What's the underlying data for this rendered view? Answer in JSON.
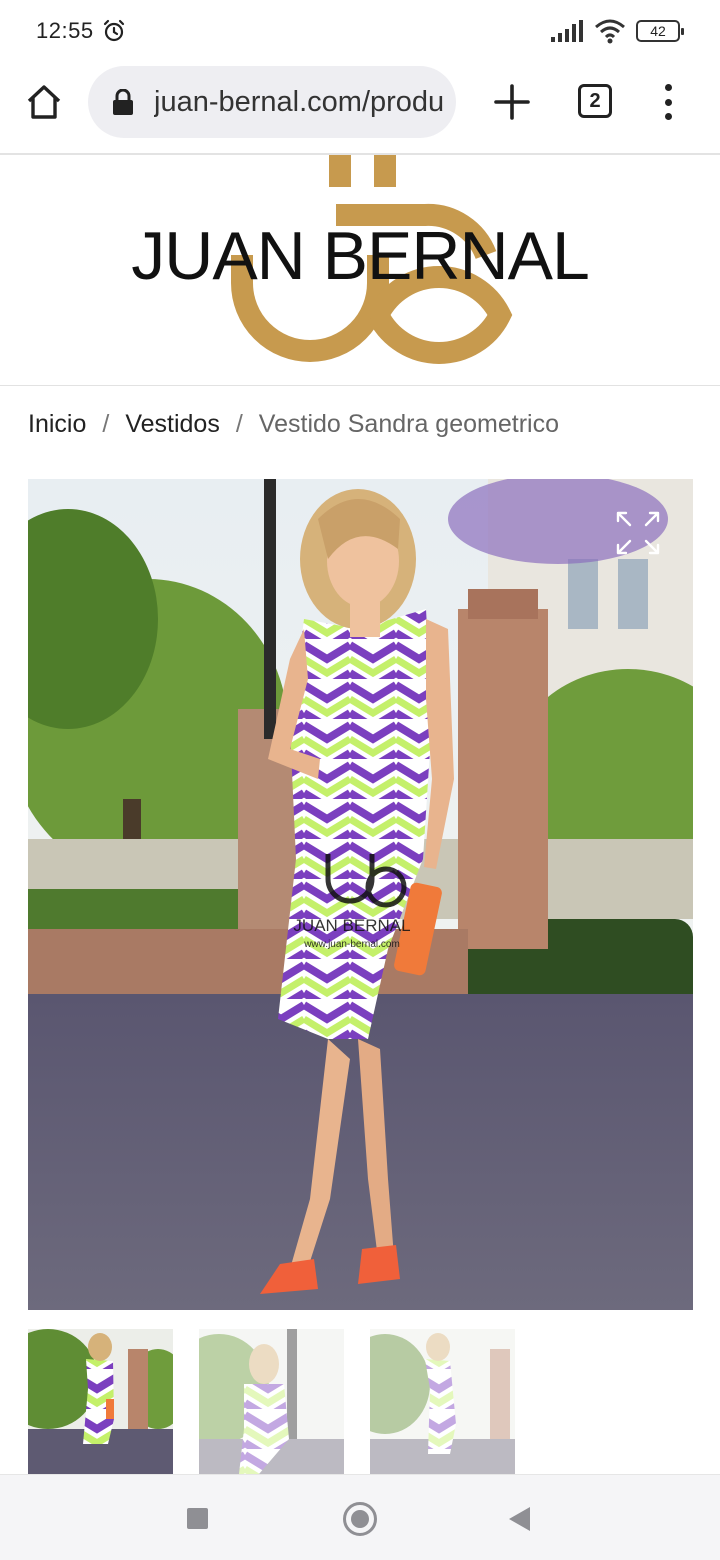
{
  "status_bar": {
    "time": "12:55",
    "battery": "42",
    "icons": [
      "alarm-icon",
      "signal-icon",
      "wifi-icon",
      "battery-icon"
    ]
  },
  "browser": {
    "url": "juan-bernal.com/produ",
    "tab_count": "2",
    "icons": [
      "home-icon",
      "lock-icon",
      "plus-icon",
      "tabs-icon",
      "menu-icon"
    ]
  },
  "logo": {
    "text": "JUAN BERNAL",
    "monogram_color": "#C79A4E"
  },
  "breadcrumb": {
    "items": [
      "Inicio",
      "Vestidos"
    ],
    "separator": "/",
    "current": "Vestido Sandra geometrico"
  },
  "product_image": {
    "watermark_text": "JUAN BERNAL",
    "watermark_url": "www.juan-bernal.com",
    "dress_colors": [
      "#7b3fbf",
      "#c4f06a",
      "#ffffff"
    ],
    "accent_color": "#f07a3a"
  },
  "thumbnails": {
    "count": 3,
    "selected_index": 0
  },
  "nav_bar": {
    "buttons": [
      "recents-button",
      "home-button",
      "back-button"
    ]
  }
}
